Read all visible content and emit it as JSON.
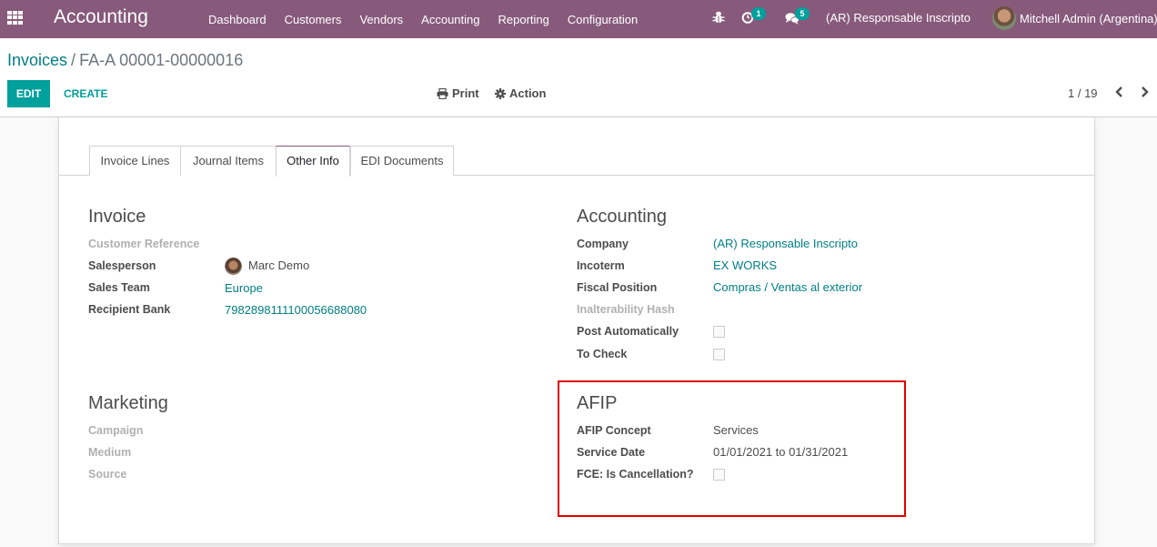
{
  "navbar": {
    "app_name": "Accounting",
    "menu": [
      "Dashboard",
      "Customers",
      "Vendors",
      "Accounting",
      "Reporting",
      "Configuration"
    ],
    "icons": {
      "apps": "apps-grid-icon",
      "debug": "bug-icon",
      "activities": "clock-icon",
      "messages": "chat-icon"
    },
    "activity_count": "1",
    "message_count": "5",
    "company": "(AR) Responsable Inscripto",
    "user": "Mitchell Admin (Argentina)",
    "color": "#875a7b",
    "badge_color": "#00a09d"
  },
  "control_panel": {
    "breadcrumb": {
      "parent": "Invoices",
      "separator": "/",
      "current": "FA-A 00001-00000016"
    },
    "edit_label": "EDIT",
    "create_label": "CREATE",
    "print_label": "Print",
    "action_label": "Action",
    "pager": "1 / 19",
    "prev_icon": "‹",
    "next_icon": "›"
  },
  "tabs": [
    {
      "label": "Invoice Lines",
      "active": false
    },
    {
      "label": "Journal Items",
      "active": false
    },
    {
      "label": "Other Info",
      "active": true
    },
    {
      "label": "EDI Documents",
      "active": false
    }
  ],
  "invoice_group": {
    "title": "Invoice",
    "customer_reference_label": "Customer Reference",
    "salesperson_label": "Salesperson",
    "salesperson_value": "Marc Demo",
    "sales_team_label": "Sales Team",
    "sales_team_value": "Europe",
    "recipient_bank_label": "Recipient Bank",
    "recipient_bank_value": "7982898111100056688080"
  },
  "accounting_group": {
    "title": "Accounting",
    "company_label": "Company",
    "company_value": "(AR) Responsable Inscripto",
    "incoterm_label": "Incoterm",
    "incoterm_value": "EX WORKS",
    "fiscal_position_label": "Fiscal Position",
    "fiscal_position_value": "Compras / Ventas al exterior",
    "hash_label": "Inalterability Hash",
    "post_auto_label": "Post Automatically",
    "post_auto_checked": false,
    "to_check_label": "To Check",
    "to_check_checked": false
  },
  "marketing_group": {
    "title": "Marketing",
    "campaign_label": "Campaign",
    "medium_label": "Medium",
    "source_label": "Source"
  },
  "afip_group": {
    "title": "AFIP",
    "concept_label": "AFIP Concept",
    "concept_value": "Services",
    "service_date_label": "Service Date",
    "service_date_value": "01/01/2021 to 01/31/2021",
    "fce_label": "FCE: Is Cancellation?",
    "fce_checked": false,
    "highlight_color": "#e00000"
  }
}
